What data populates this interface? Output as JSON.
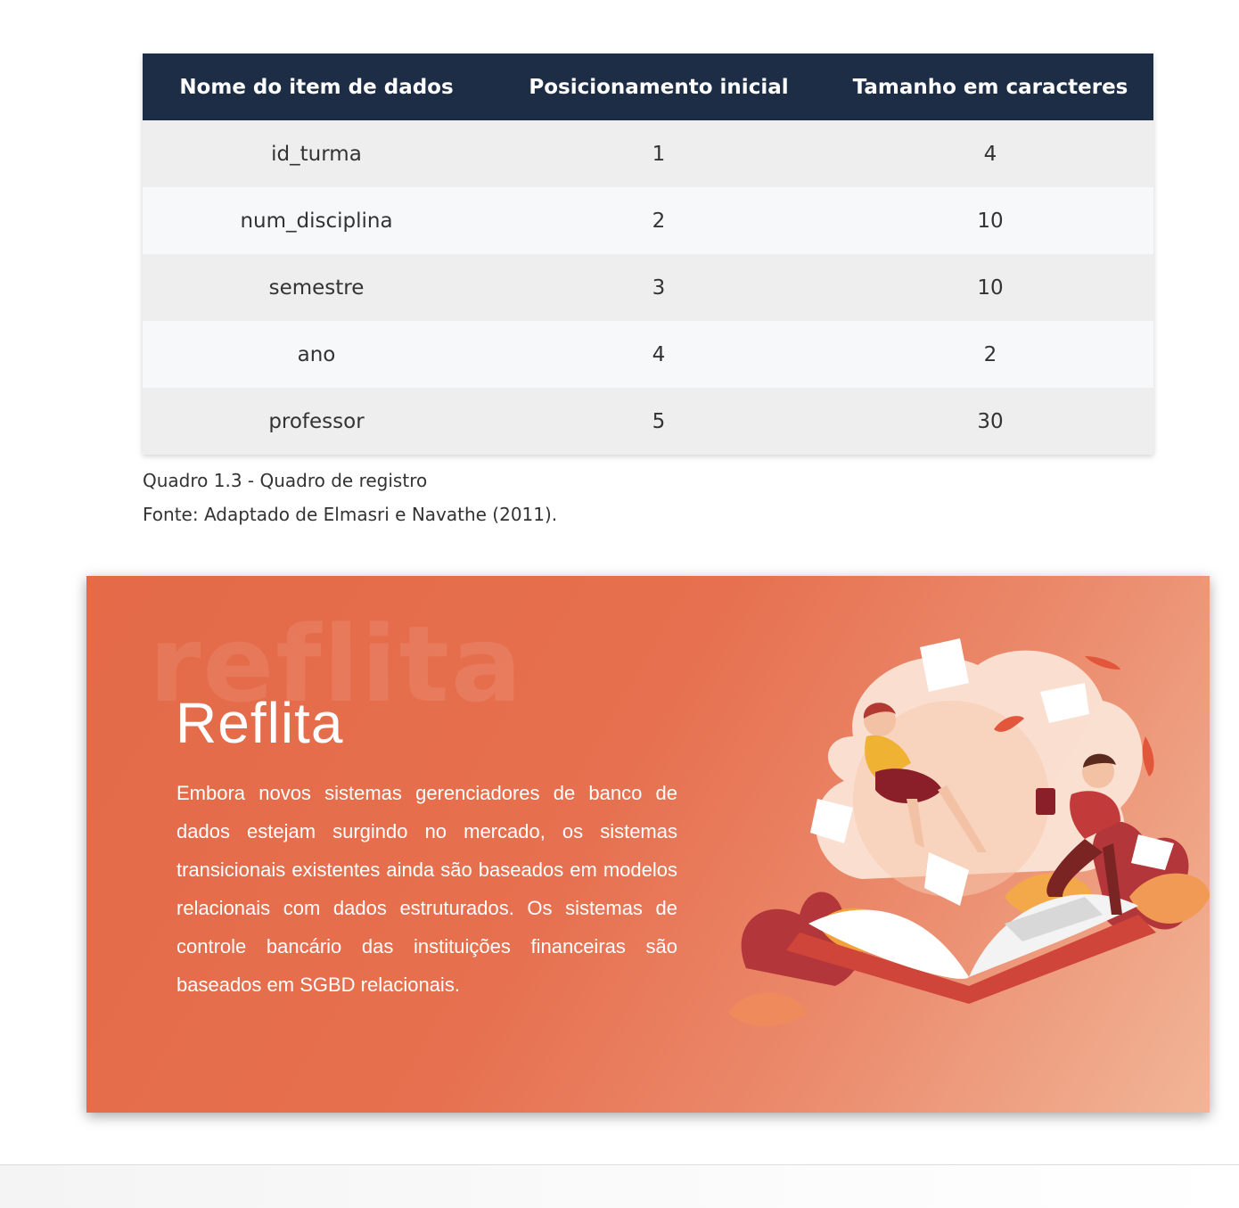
{
  "table": {
    "headers": [
      "Nome do item de dados",
      "Posicionamento inicial",
      "Tamanho em caracteres"
    ],
    "rows": [
      [
        "id_turma",
        "1",
        "4"
      ],
      [
        "num_disciplina",
        "2",
        "10"
      ],
      [
        "semestre",
        "3",
        "10"
      ],
      [
        "ano",
        "4",
        "2"
      ],
      [
        "professor",
        "5",
        "30"
      ]
    ]
  },
  "caption": {
    "line1": "Quadro 1.3 - Quadro de registro",
    "line2": "Fonte: Adaptado de Elmasri e Navathe (2011)."
  },
  "reflita": {
    "watermark": "reflita",
    "title": "Reflita",
    "body": "Embora novos sistemas gerenciadores de banco de dados estejam surgindo no mercado, os sistemas transicionais existentes ainda são baseados em modelos relacionais com dados estruturados. Os sistemas de controle bancário das instituições financeiras são baseados em SGBD relacionais.",
    "bg_color": "#e46a48",
    "illustration": "reading-book-illustration"
  }
}
